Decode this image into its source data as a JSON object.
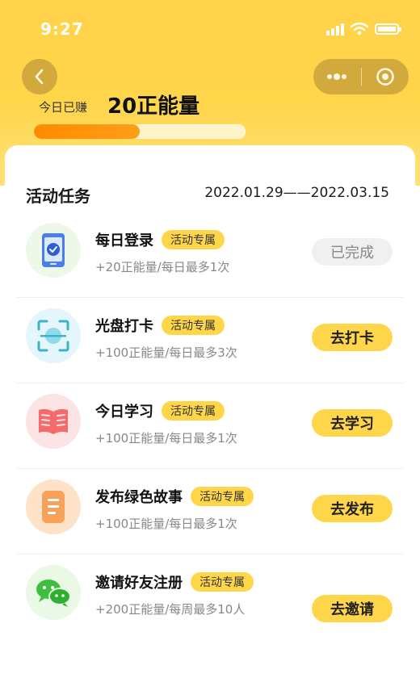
{
  "status_bar": {
    "time": "9:27"
  },
  "header": {
    "earned_label": "今日已赚",
    "earned_value": "20正能量",
    "progress_fraction": 0.5
  },
  "section": {
    "title": "活动任务",
    "date_range": "2022.01.29——2022.03.15"
  },
  "tasks": [
    {
      "icon": "phone-check-icon",
      "name": "每日登录",
      "tag": "活动专属",
      "desc": "+20正能量/每日最多1次",
      "button": "已完成",
      "status": "done"
    },
    {
      "icon": "scan-icon",
      "name": "光盘打卡",
      "tag": "活动专属",
      "desc": "+100正能量/每日最多3次",
      "button": "去打卡",
      "status": "todo"
    },
    {
      "icon": "book-icon",
      "name": "今日学习",
      "tag": "活动专属",
      "desc": "+100正能量/每日最多1次",
      "button": "去学习",
      "status": "todo"
    },
    {
      "icon": "document-icon",
      "name": "发布绿色故事",
      "tag": "活动专属",
      "desc": "+100正能量/每日最多1次",
      "button": "去发布",
      "status": "todo"
    },
    {
      "icon": "wechat-icon",
      "name": "邀请好友注册",
      "tag": "活动专属",
      "desc": "+200正能量/每周最多10人",
      "button": "去邀请",
      "status": "todo"
    }
  ],
  "colors": {
    "accent": "#ffd54a",
    "progress": "#ff8a00"
  }
}
